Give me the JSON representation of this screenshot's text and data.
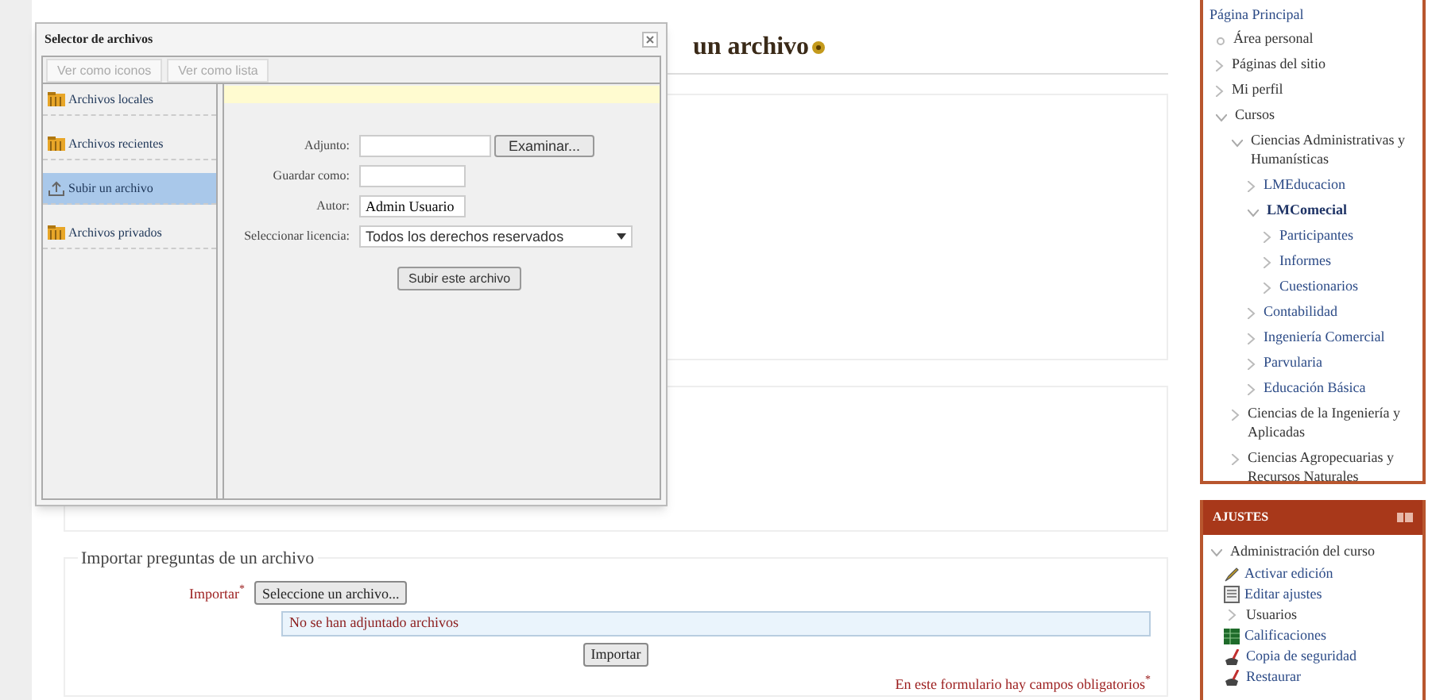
{
  "heading": {
    "text": "un archivo"
  },
  "import_form": {
    "legend": "Importar preguntas de un archivo",
    "label": "Importar",
    "required_mark": "*",
    "choose_button": "Seleccione un archivo...",
    "status": "No se han adjuntado archivos",
    "submit_button": "Importar",
    "required_note": "En este formulario hay campos obligatorios",
    "required_note_mark": "*"
  },
  "navigation": {
    "title": "Página Principal",
    "items": [
      {
        "label": "Área personal",
        "kind": "leaf",
        "selected": false
      },
      {
        "label": "Páginas del sitio",
        "kind": "branch",
        "expanded": false,
        "selected": false
      },
      {
        "label": "Mi perfil",
        "kind": "branch",
        "expanded": false,
        "selected": false
      },
      {
        "label": "Cursos",
        "kind": "branch",
        "expanded": true,
        "selected": false,
        "children": [
          {
            "label": "Ciencias Administrativas y Humanísticas",
            "kind": "branch",
            "expanded": true,
            "selected": false,
            "children": [
              {
                "label": "LMEducacion",
                "kind": "branch",
                "expanded": false,
                "selected": false
              },
              {
                "label": "LMComecial",
                "kind": "branch",
                "expanded": true,
                "selected": true,
                "children": [
                  {
                    "label": "Participantes",
                    "kind": "branch",
                    "expanded": false,
                    "selected": false
                  },
                  {
                    "label": "Informes",
                    "kind": "branch",
                    "expanded": false,
                    "selected": false
                  },
                  {
                    "label": "Cuestionarios",
                    "kind": "branch",
                    "expanded": false,
                    "selected": false
                  }
                ]
              },
              {
                "label": "Contabilidad",
                "kind": "branch",
                "expanded": false,
                "selected": false
              },
              {
                "label": "Ingeniería Comercial",
                "kind": "branch",
                "expanded": false,
                "selected": false
              },
              {
                "label": "Parvularia",
                "kind": "branch",
                "expanded": false,
                "selected": false
              },
              {
                "label": "Educación Básica",
                "kind": "branch",
                "expanded": false,
                "selected": false
              }
            ]
          },
          {
            "label": "Ciencias de la Ingeniería y Aplicadas",
            "kind": "branch",
            "expanded": false,
            "selected": false
          },
          {
            "label": "Ciencias Agropecuarias y Recursos Naturales",
            "kind": "branch",
            "expanded": false,
            "selected": false
          }
        ]
      }
    ]
  },
  "settings": {
    "title": "AJUSTES",
    "section": "Administración del curso",
    "section_expanded": true,
    "items": [
      {
        "label": "Activar edición",
        "kind": "edit"
      },
      {
        "label": "Editar ajustes",
        "kind": "document"
      },
      {
        "label": "Usuarios",
        "kind": "branch"
      },
      {
        "label": "Calificaciones",
        "kind": "grades"
      },
      {
        "label": "Copia de seguridad",
        "kind": "backup"
      },
      {
        "label": "Restaurar",
        "kind": "restore"
      }
    ]
  },
  "file_picker": {
    "title": "Selector de archivos",
    "view_tabs": [
      {
        "label": "Ver como iconos",
        "disabled": true
      },
      {
        "label": "Ver como lista",
        "disabled": true
      }
    ],
    "repositories": [
      {
        "label": "Archivos locales",
        "kind": "folder",
        "selected": false
      },
      {
        "label": "Archivos recientes",
        "kind": "folder",
        "selected": false
      },
      {
        "label": "Subir un archivo",
        "kind": "upload",
        "selected": true
      },
      {
        "label": "Archivos privados",
        "kind": "folder",
        "selected": false
      }
    ],
    "fields": [
      {
        "label": "Adjunto:",
        "kind": "file",
        "button": "Examinar..."
      },
      {
        "label": "Guardar como:",
        "kind": "text"
      },
      {
        "label": "Autor:",
        "kind": "text",
        "value": "Admin Usuario"
      },
      {
        "label": "Seleccionar licencia:",
        "kind": "select",
        "value": "Todos los derechos reservados"
      }
    ],
    "upload_button": "Subir este archivo"
  }
}
